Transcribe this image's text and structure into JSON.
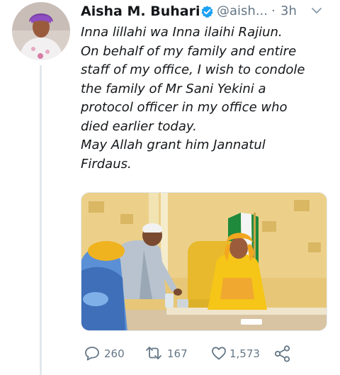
{
  "tweet": {
    "author_name": "Aisha M. Buhari",
    "handle": "@aish...",
    "separator": "·",
    "timestamp": "3h",
    "lines": [
      "Inna lillahi wa Inna ilaihi Rajiun.",
      "On behalf of my family and entire",
      "staff of my office, I wish to condole",
      "the family of Mr Sani Yekini a",
      "protocol officer in my office who",
      "died earlier today.",
      "May Allah grant him Jannatul",
      "Firdaus."
    ]
  },
  "actions": {
    "replies": "260",
    "retweets": "167",
    "likes": "1,573"
  },
  "icons": {
    "avatar": "avatar-photo",
    "verified": "verified-badge-icon",
    "menu": "chevron-down-icon",
    "reply": "reply-icon",
    "retweet": "retweet-icon",
    "like": "heart-icon",
    "share": "share-icon"
  },
  "colors": {
    "text": "#14171a",
    "muted": "#657786",
    "verified": "#1da1f2",
    "divider": "#e1e8ed"
  }
}
